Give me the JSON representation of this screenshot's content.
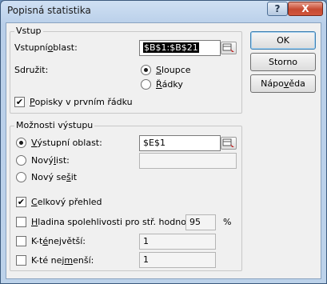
{
  "title": "Popisná statistika",
  "titlebar": {
    "help_glyph": "?",
    "close_glyph": "X"
  },
  "input_group": {
    "legend": "Vstup",
    "input_range": {
      "pre": "Vstupní ",
      "u": "o",
      "post": "blast:",
      "value": "$B$1:$B$21"
    },
    "group_by": {
      "label": "Sdružit:",
      "columns": {
        "u": "S",
        "post": "loupce",
        "selected": true
      },
      "rows": {
        "u": "Ř",
        "post": "ádky",
        "selected": false
      }
    },
    "labels_first_row": {
      "u": "P",
      "post": "opisky v prvním řádku",
      "checked": true
    }
  },
  "output_group": {
    "legend": "Možnosti výstupu",
    "output_range": {
      "pre": "",
      "u": "V",
      "post": "ýstupní oblast:",
      "value": "$E$1",
      "selected": true
    },
    "new_sheet": {
      "pre": "Nový ",
      "u": "l",
      "post": "ist:",
      "value": "",
      "selected": false
    },
    "new_workbook": {
      "pre": "Nový se",
      "u": "š",
      "post": "it",
      "selected": false
    },
    "summary": {
      "pre": "",
      "u": "C",
      "post": "elkový přehled",
      "checked": true
    },
    "confidence": {
      "pre": "",
      "u": "H",
      "post": "ladina spolehlivosti pro stř. hodnotu:",
      "value": "95",
      "unit": "%",
      "checked": false
    },
    "kth_largest": {
      "pre": "K-t",
      "u": "é",
      "post": " největší:",
      "value": "1",
      "checked": false
    },
    "kth_smallest": {
      "pre": "K-té nej",
      "u": "m",
      "post": "enší:",
      "value": "1",
      "checked": false
    }
  },
  "buttons": {
    "ok": "OK",
    "cancel": "Storno",
    "help": {
      "pre": "Nápo",
      "u": "v",
      "post": "ěda"
    }
  },
  "check_glyph": "✔"
}
